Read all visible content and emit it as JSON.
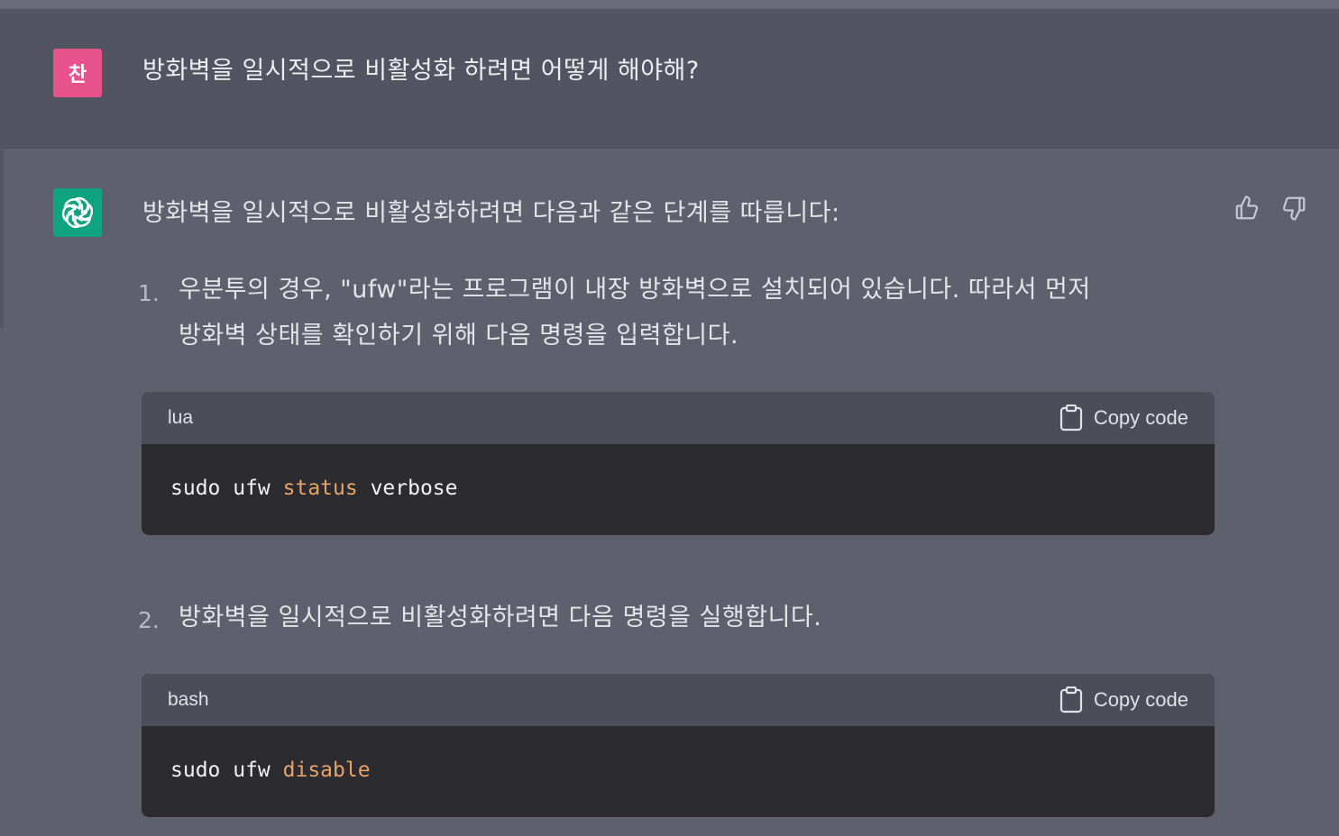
{
  "user_message": {
    "avatar_text": "찬",
    "avatar_color": "#e9538b",
    "text": "방화벽을 일시적으로 비활성화 하려면 어떻게 해야해?"
  },
  "assistant_message": {
    "avatar_icon": "openai-logo-icon",
    "avatar_color": "#10a37f",
    "intro": "방화벽을 일시적으로 비활성화하려면 다음과 같은 단계를 따릅니다:",
    "feedback": {
      "thumbs_up_icon": "thumbs-up-icon",
      "thumbs_down_icon": "thumbs-down-icon"
    },
    "steps": [
      {
        "number": "1.",
        "line1": "우분투의 경우, \"ufw\"라는 프로그램이 내장 방화벽으로 설치되어 있습니다. 따라서 먼저",
        "line2": "방화벽 상태를 확인하기 위해 다음 명령을 입력합니다.",
        "code": {
          "language": "lua",
          "copy_label": "Copy code",
          "plain": "sudo ufw ",
          "keyword": "status",
          "rest": " verbose"
        }
      },
      {
        "number": "2.",
        "line1": "방화벽을 일시적으로 비활성화하려면 다음 명령을 실행합니다.",
        "code": {
          "language": "bash",
          "copy_label": "Copy code",
          "plain": "sudo ufw ",
          "keyword": "disable",
          "rest": ""
        }
      }
    ]
  },
  "colors": {
    "keyword": "#e7a36a",
    "code_bg": "#2b2b30",
    "code_header_bg": "#4c4d59"
  }
}
